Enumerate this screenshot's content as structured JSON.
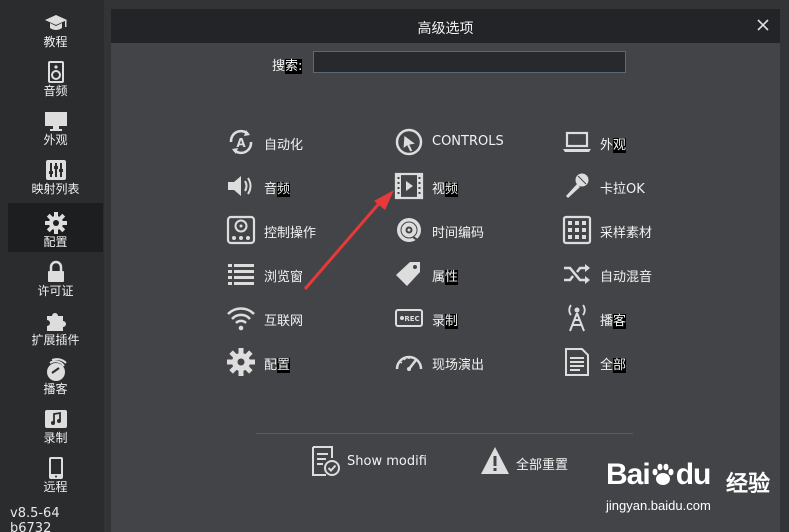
{
  "sidebar": {
    "items": [
      {
        "label": "教程",
        "icon": "graduation-cap-icon"
      },
      {
        "label": "音频",
        "icon": "speaker-icon"
      },
      {
        "label": "外观",
        "icon": "monitor-icon"
      },
      {
        "label": "映射列表",
        "icon": "mixer-icon"
      },
      {
        "label": "配置",
        "icon": "gear-icon",
        "active": true
      },
      {
        "label": "许可证",
        "icon": "lock-icon"
      },
      {
        "label": "扩展插件",
        "icon": "puzzle-icon"
      },
      {
        "label": "播客",
        "icon": "podcast-icon"
      },
      {
        "label": "录制",
        "icon": "music-note-icon"
      },
      {
        "label": "远程",
        "icon": "tablet-icon"
      }
    ],
    "version": "v8.5-64 b6732"
  },
  "dialog": {
    "title": "高级选项",
    "close_label": "×",
    "search": {
      "label_pre": "搜",
      "label_hl": "索:",
      "value": "",
      "placeholder": ""
    },
    "options": [
      {
        "label": "自动化",
        "hl": "",
        "icon": "automation-icon"
      },
      {
        "label": "CONTROLS",
        "hl": "",
        "icon": "cursor-icon"
      },
      {
        "label": "外",
        "hl": "观",
        "icon": "laptop-icon"
      },
      {
        "label": "音",
        "hl": "频",
        "icon": "volume-icon"
      },
      {
        "label": "视",
        "hl": "频",
        "icon": "video-icon"
      },
      {
        "label": "卡拉OK",
        "hl": "",
        "icon": "microphone-icon"
      },
      {
        "label": "控制操作",
        "hl": "",
        "icon": "controller-icon"
      },
      {
        "label": "时间编码",
        "hl": "",
        "icon": "disc-icon"
      },
      {
        "label": "采样素材",
        "hl": "",
        "icon": "sampler-grid-icon"
      },
      {
        "label": "浏览窗",
        "hl": "",
        "icon": "list-icon"
      },
      {
        "label": "属",
        "hl": "性",
        "icon": "tag-icon"
      },
      {
        "label": "自动混音",
        "hl": "",
        "icon": "shuffle-icon"
      },
      {
        "label": "互联网",
        "hl": "",
        "icon": "wifi-icon"
      },
      {
        "label": "录",
        "hl": "制",
        "icon": "rec-icon"
      },
      {
        "label": "播",
        "hl": "客",
        "icon": "antenna-icon"
      },
      {
        "label": "配",
        "hl": "置",
        "icon": "gear-icon"
      },
      {
        "label": "现场演出",
        "hl": "",
        "icon": "gauge-icon"
      },
      {
        "label": "全",
        "hl": "部",
        "icon": "document-icon"
      }
    ],
    "footer": {
      "show_modified": "Show modifi",
      "reset_all": "全部重置"
    }
  },
  "watermark": {
    "logo": "Bai",
    "logo_paw": "du",
    "tag": "经验",
    "url": "jingyan.baidu.com"
  },
  "colors": {
    "background": "#333436",
    "sidebar": "#2b2c2e",
    "dialog": "#434447",
    "titlebar": "#232427",
    "accent_arrow": "#e8393a"
  }
}
